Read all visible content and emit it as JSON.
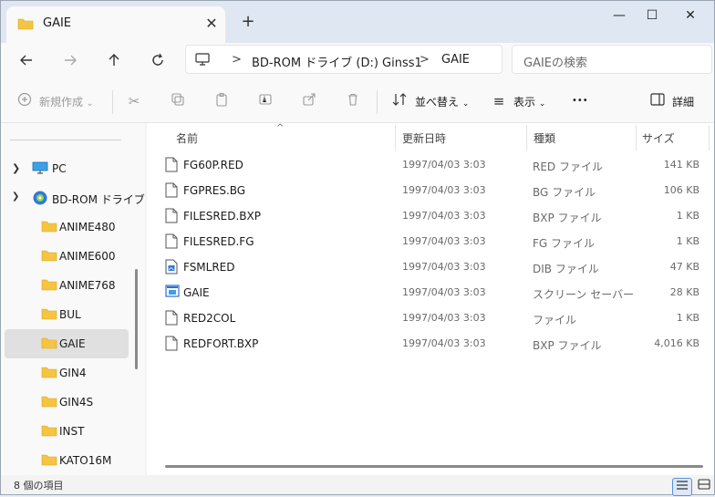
{
  "window": {
    "tab_title": "GAIE",
    "close_tab": "✕",
    "new_tab": "+",
    "minimize": "—",
    "maximize": "☐",
    "close": "✕"
  },
  "address": {
    "segments": [
      "BD-ROM ドライブ (D:) Ginss1",
      "GAIE"
    ],
    "separator": ">"
  },
  "search": {
    "placeholder": "GAIEの検索"
  },
  "toolbar": {
    "new": "新規作成",
    "sort": "並べ替え",
    "view": "表示",
    "more": "•••",
    "details": "詳細"
  },
  "sidebar": {
    "items": [
      {
        "label": "PC",
        "chevron": ">"
      },
      {
        "label": "BD-ROM ドライブ",
        "chevron": "v"
      },
      {
        "label": "ANIME480"
      },
      {
        "label": "ANIME600"
      },
      {
        "label": "ANIME768"
      },
      {
        "label": "BUL"
      },
      {
        "label": "GAIE"
      },
      {
        "label": "GIN4"
      },
      {
        "label": "GIN4S"
      },
      {
        "label": "INST"
      },
      {
        "label": "KATO16M"
      }
    ]
  },
  "columns": {
    "name": "名前",
    "date": "更新日時",
    "type": "種類",
    "size": "サイズ"
  },
  "files": [
    {
      "name": "FG60P.RED",
      "date": "1997/04/03 3:03",
      "type": "RED ファイル",
      "size": "141 KB",
      "icon": "document-icon"
    },
    {
      "name": "FGPRES.BG",
      "date": "1997/04/03 3:03",
      "type": "BG ファイル",
      "size": "106 KB",
      "icon": "document-icon"
    },
    {
      "name": "FILESRED.BXP",
      "date": "1997/04/03 3:03",
      "type": "BXP ファイル",
      "size": "1 KB",
      "icon": "document-icon"
    },
    {
      "name": "FILESRED.FG",
      "date": "1997/04/03 3:03",
      "type": "FG ファイル",
      "size": "1 KB",
      "icon": "document-icon"
    },
    {
      "name": "FSMLRED",
      "date": "1997/04/03 3:03",
      "type": "DIB ファイル",
      "size": "47 KB",
      "icon": "image-file-icon"
    },
    {
      "name": "GAIE",
      "date": "1997/04/03 3:03",
      "type": "スクリーン セーバー",
      "size": "28 KB",
      "icon": "screensaver-icon"
    },
    {
      "name": "RED2COL",
      "date": "1997/04/03 3:03",
      "type": "ファイル",
      "size": "1 KB",
      "icon": "document-icon"
    },
    {
      "name": "REDFORT.BXP",
      "date": "1997/04/03 3:03",
      "type": "BXP ファイル",
      "size": "4,016 KB",
      "icon": "document-icon"
    }
  ],
  "status": {
    "count_text": "8 個の項目"
  },
  "colors": {
    "folder": "#f5c542",
    "selection": "#e0e0e0",
    "accent": "#2f6fd0"
  }
}
